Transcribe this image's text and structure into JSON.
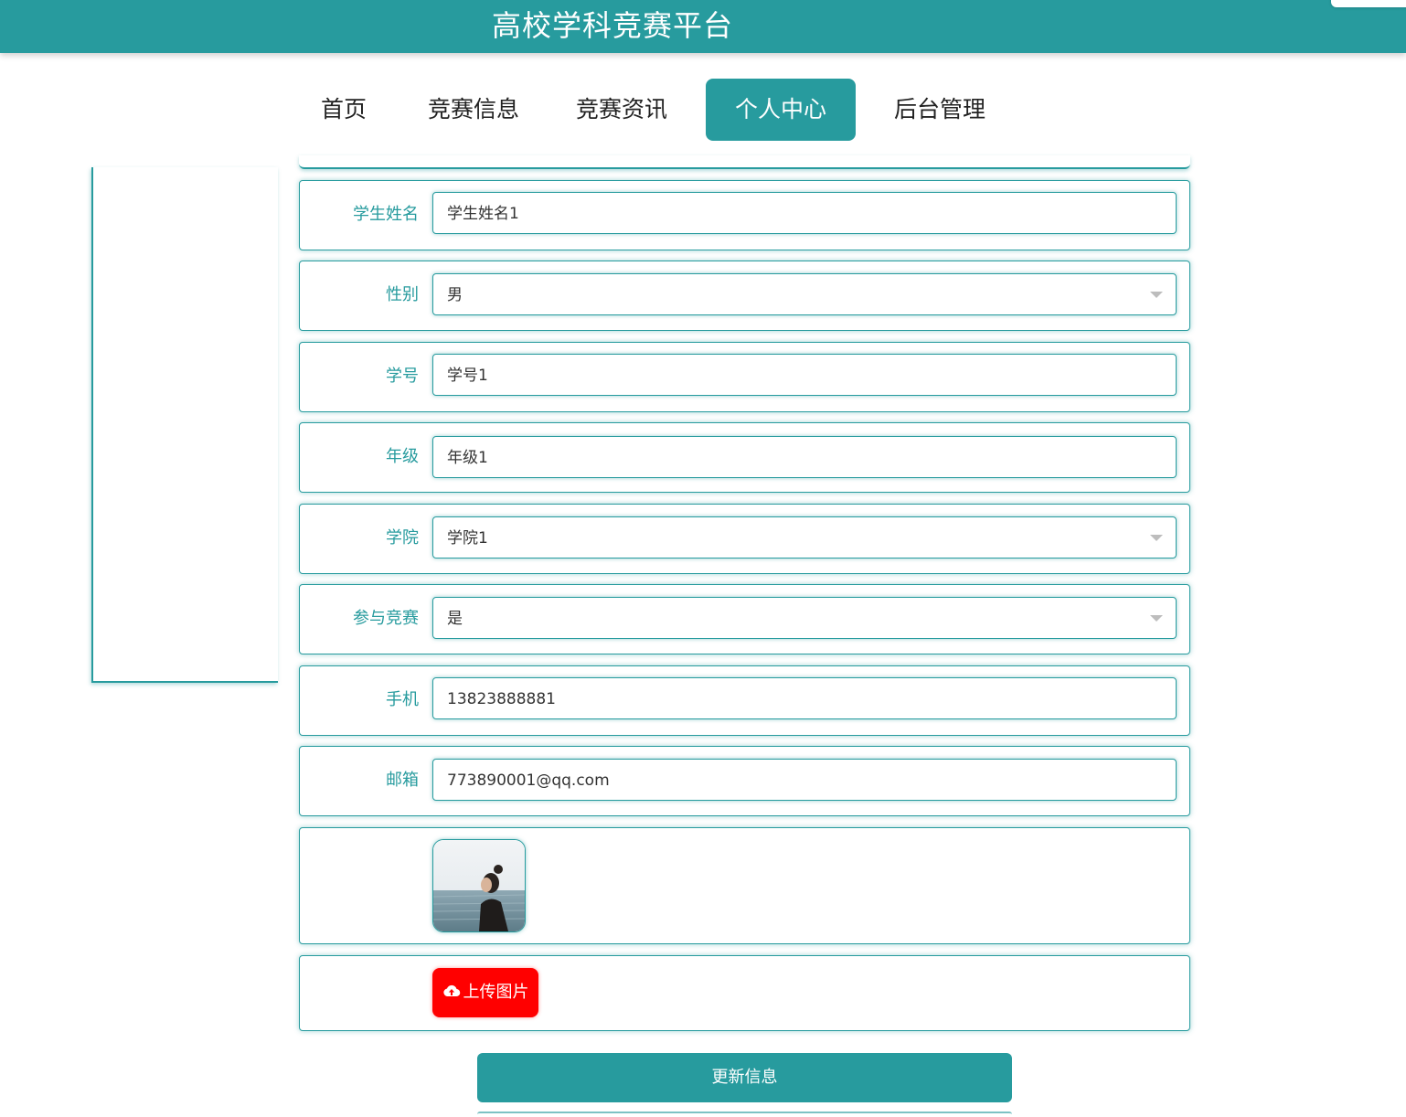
{
  "header": {
    "title": "高校学科竞赛平台"
  },
  "nav": {
    "items": [
      {
        "label": "首页",
        "active": false
      },
      {
        "label": "竞赛信息",
        "active": false
      },
      {
        "label": "竞赛资讯",
        "active": false
      },
      {
        "label": "个人中心",
        "active": true
      },
      {
        "label": "后台管理",
        "active": false
      }
    ]
  },
  "form": {
    "student_name": {
      "label": "学生姓名",
      "value": "学生姓名1"
    },
    "gender": {
      "label": "性别",
      "value": "男"
    },
    "student_no": {
      "label": "学号",
      "value": "学号1"
    },
    "grade": {
      "label": "年级",
      "value": "年级1"
    },
    "college": {
      "label": "学院",
      "value": "学院1"
    },
    "participate": {
      "label": "参与竞赛",
      "value": "是"
    },
    "phone": {
      "label": "手机",
      "value": "13823888881"
    },
    "email": {
      "label": "邮箱",
      "value": "773890001@qq.com"
    },
    "upload_label": "上传图片",
    "submit_label": "更新信息"
  },
  "colors": {
    "accent": "#279b9e",
    "upload": "#ff0000"
  },
  "icons": {
    "upload": "cloud-upload-icon",
    "select": "chevron-down-icon"
  }
}
